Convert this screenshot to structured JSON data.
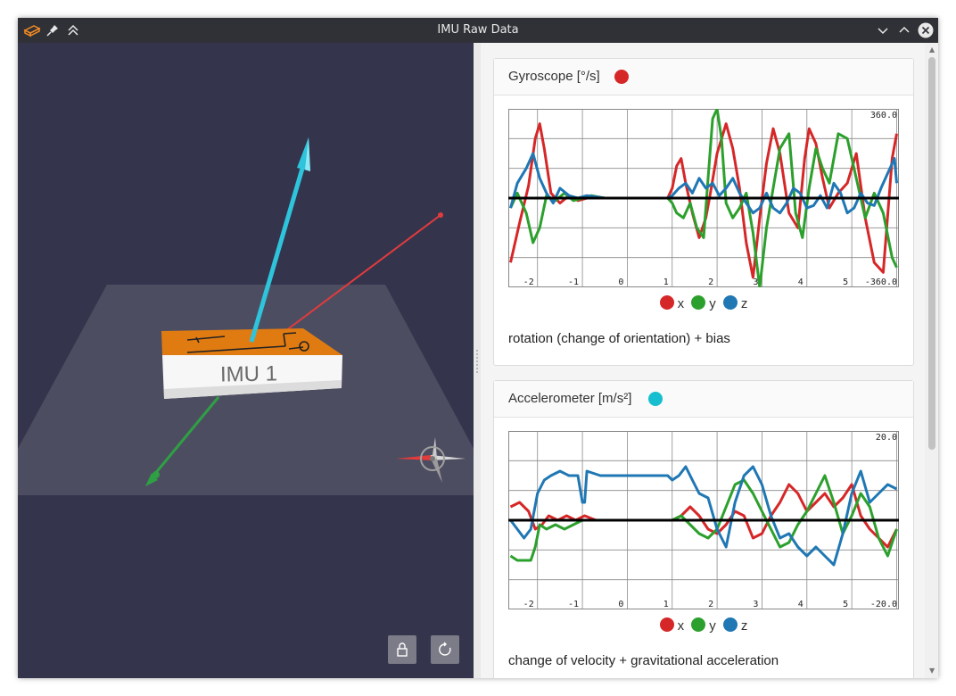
{
  "window": {
    "title": "IMU Raw Data",
    "icons": [
      "app-icon",
      "pin-icon",
      "keep-above-icon",
      "minimize-icon",
      "maximize-icon",
      "close-icon"
    ]
  },
  "viewport": {
    "device_label": "IMU 1",
    "axis_colors": {
      "x": "#e03c3c",
      "y": "#2ea043",
      "z": "#2ec4dc"
    },
    "board_color": "#e07b12",
    "background": "#35344d",
    "buttons": [
      "lock-icon",
      "reset-icon"
    ]
  },
  "panels": {
    "gyro": {
      "title": "Gyroscope [°/s]",
      "status_color": "#d62728",
      "description": "rotation (change of orientation) + bias",
      "chart_data": {
        "type": "line",
        "ymax_label": "360.0",
        "ymin_label": "-360.0",
        "ylim": [
          -360,
          360
        ],
        "xlim": [
          -2.65,
          6.05
        ],
        "xticks": [
          "-2",
          "-1",
          "0",
          "1",
          "2",
          "3",
          "4",
          "5"
        ],
        "legend": [
          "x",
          "y",
          "z"
        ],
        "colors": [
          "#d62728",
          "#2ca02c",
          "#1f77b4"
        ],
        "series": [
          {
            "name": "x",
            "x": [
              -2.6,
              -2.4,
              -2.2,
              -2.05,
              -1.95,
              -1.85,
              -1.7,
              -1.5,
              -1.3,
              -1.1,
              -0.9,
              -0.5,
              0,
              0.5,
              0.9,
              1.0,
              1.1,
              1.2,
              1.3,
              1.45,
              1.6,
              1.75,
              1.85,
              2.0,
              2.2,
              2.35,
              2.5,
              2.65,
              2.8,
              2.95,
              3.1,
              3.25,
              3.4,
              3.6,
              3.8,
              3.95,
              4.05,
              4.2,
              4.35,
              4.5,
              4.7,
              4.9,
              5.1,
              5.3,
              5.5,
              5.7,
              5.9,
              6.0
            ],
            "y": [
              -260,
              -100,
              50,
              240,
              300,
              200,
              20,
              -20,
              10,
              -10,
              0,
              0,
              0,
              0,
              0,
              40,
              130,
              160,
              60,
              -60,
              -160,
              -80,
              20,
              180,
              300,
              200,
              40,
              -180,
              -320,
              -80,
              140,
              280,
              180,
              -60,
              -120,
              160,
              280,
              220,
              80,
              -40,
              20,
              60,
              180,
              -80,
              -260,
              -300,
              160,
              260
            ]
          },
          {
            "name": "y",
            "x": [
              -2.6,
              -2.45,
              -2.25,
              -2.1,
              -1.95,
              -1.8,
              -1.6,
              -1.4,
              -1.2,
              -1.0,
              -0.8,
              -0.5,
              0,
              0.5,
              0.9,
              1.0,
              1.1,
              1.25,
              1.4,
              1.55,
              1.7,
              1.8,
              1.9,
              2.0,
              2.1,
              2.2,
              2.35,
              2.5,
              2.65,
              2.8,
              2.95,
              3.1,
              3.25,
              3.4,
              3.6,
              3.75,
              3.9,
              4.05,
              4.2,
              4.35,
              4.5,
              4.7,
              4.9,
              5.1,
              5.3,
              5.5,
              5.7,
              5.9,
              6.0
            ],
            "y": [
              -40,
              20,
              -60,
              -180,
              -120,
              10,
              -10,
              20,
              -10,
              0,
              10,
              0,
              0,
              0,
              0,
              -20,
              -60,
              -80,
              -20,
              -120,
              -160,
              80,
              320,
              360,
              240,
              -20,
              -80,
              -40,
              20,
              -140,
              -360,
              -120,
              40,
              200,
              260,
              -60,
              -160,
              40,
              200,
              120,
              60,
              260,
              240,
              80,
              -80,
              20,
              -60,
              -240,
              -280
            ]
          },
          {
            "name": "z",
            "x": [
              -2.6,
              -2.45,
              -2.25,
              -2.1,
              -1.95,
              -1.8,
              -1.65,
              -1.5,
              -1.3,
              -1.1,
              -0.9,
              -0.5,
              0,
              0.5,
              0.9,
              1.0,
              1.15,
              1.3,
              1.45,
              1.6,
              1.75,
              1.9,
              2.05,
              2.2,
              2.35,
              2.5,
              2.65,
              2.8,
              2.95,
              3.1,
              3.25,
              3.4,
              3.55,
              3.7,
              3.85,
              4.0,
              4.15,
              4.3,
              4.45,
              4.6,
              4.75,
              4.9,
              5.05,
              5.2,
              5.35,
              5.5,
              5.65,
              5.8,
              5.95,
              6.0
            ],
            "y": [
              -40,
              60,
              120,
              180,
              80,
              20,
              -20,
              40,
              10,
              0,
              10,
              0,
              0,
              0,
              0,
              10,
              40,
              60,
              20,
              80,
              40,
              60,
              10,
              40,
              80,
              20,
              -20,
              -60,
              -40,
              20,
              -40,
              -60,
              -20,
              40,
              20,
              -40,
              -30,
              10,
              -40,
              60,
              20,
              -60,
              -40,
              20,
              -20,
              -30,
              40,
              100,
              160,
              60
            ]
          }
        ]
      }
    },
    "accel": {
      "title": "Accelerometer [m/s²]",
      "status_color": "#17becf",
      "description": "change of velocity + gravitational acceleration",
      "chart_data": {
        "type": "line",
        "ymax_label": "20.0",
        "ymin_label": "-20.0",
        "ylim": [
          -20,
          20
        ],
        "xlim": [
          -2.65,
          6.05
        ],
        "xticks": [
          "-2",
          "-1",
          "0",
          "1",
          "2",
          "3",
          "4",
          "5"
        ],
        "legend": [
          "x",
          "y",
          "z"
        ],
        "colors": [
          "#d62728",
          "#2ca02c",
          "#1f77b4"
        ],
        "series": [
          {
            "name": "x",
            "x": [
              -2.6,
              -2.4,
              -2.2,
              -2.05,
              -1.9,
              -1.75,
              -1.55,
              -1.35,
              -1.15,
              -0.95,
              -0.7,
              -0.4,
              0,
              0.5,
              1.0,
              1.2,
              1.4,
              1.6,
              1.8,
              2.0,
              2.2,
              2.4,
              2.6,
              2.8,
              3.0,
              3.2,
              3.4,
              3.6,
              3.8,
              4.0,
              4.2,
              4.4,
              4.6,
              4.8,
              5.0,
              5.2,
              5.4,
              5.6,
              5.8,
              6.0
            ],
            "y": [
              3,
              4,
              2,
              -2,
              -1,
              1,
              0,
              1,
              0,
              1,
              0,
              0,
              0,
              0,
              0,
              1,
              3,
              1,
              -2,
              -3,
              -1,
              2,
              1,
              -4,
              -3,
              1,
              4,
              8,
              6,
              2,
              4,
              6,
              3,
              5,
              8,
              1,
              -2,
              -4,
              -6,
              -2
            ]
          },
          {
            "name": "y",
            "x": [
              -2.6,
              -2.45,
              -2.3,
              -2.15,
              -2.05,
              -1.95,
              -1.8,
              -1.6,
              -1.4,
              -1.2,
              -1.0,
              -0.8,
              -0.4,
              0,
              0.5,
              1.0,
              1.2,
              1.4,
              1.6,
              1.8,
              2.0,
              2.2,
              2.4,
              2.6,
              2.8,
              3.0,
              3.2,
              3.4,
              3.6,
              3.8,
              4.0,
              4.2,
              4.4,
              4.6,
              4.8,
              5.0,
              5.2,
              5.4,
              5.6,
              5.8,
              6.0
            ],
            "y": [
              -8,
              -9,
              -9,
              -9,
              -6,
              -1,
              -2,
              -1,
              -2,
              -1,
              0,
              0,
              0,
              0,
              0,
              0,
              1,
              -1,
              -3,
              -4,
              -2,
              3,
              8,
              9,
              6,
              2,
              -2,
              -6,
              -5,
              -1,
              2,
              6,
              10,
              4,
              -3,
              1,
              6,
              3,
              -4,
              -8,
              -2
            ]
          },
          {
            "name": "z",
            "x": [
              -2.6,
              -2.45,
              -2.3,
              -2.15,
              -2.0,
              -1.85,
              -1.7,
              -1.5,
              -1.3,
              -1.1,
              -1.0,
              -0.95,
              -0.9,
              -0.6,
              -0.2,
              0,
              0.5,
              0.9,
              1.0,
              1.15,
              1.3,
              1.45,
              1.6,
              1.8,
              2.0,
              2.2,
              2.4,
              2.6,
              2.8,
              3.0,
              3.2,
              3.4,
              3.6,
              3.8,
              4.0,
              4.2,
              4.4,
              4.6,
              4.8,
              5.0,
              5.2,
              5.4,
              5.6,
              5.8,
              6.0
            ],
            "y": [
              0,
              -2,
              -4,
              -2,
              6,
              9,
              10,
              11,
              10,
              10,
              4,
              4,
              11,
              10,
              10,
              10,
              10,
              10,
              9,
              10,
              12,
              9,
              6,
              5,
              -2,
              -6,
              4,
              10,
              12,
              8,
              1,
              -4,
              -3,
              -6,
              -8,
              -6,
              -8,
              -10,
              -3,
              6,
              11,
              4,
              6,
              8,
              7
            ]
          }
        ]
      }
    }
  }
}
